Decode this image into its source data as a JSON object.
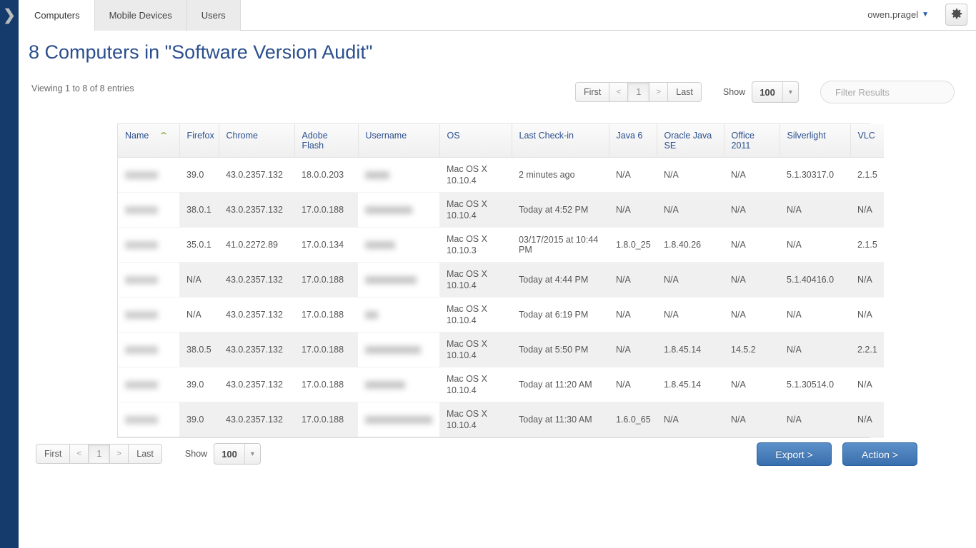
{
  "sidebar": {
    "toggle_icon": "chevron-right-icon"
  },
  "header": {
    "tabs": [
      {
        "label": "Computers",
        "active": true
      },
      {
        "label": "Mobile Devices",
        "active": false
      },
      {
        "label": "Users",
        "active": false
      }
    ],
    "username": "owen.pragel",
    "caret": "▼",
    "gear_icon": "gear-icon"
  },
  "page": {
    "title": "8 Computers in \"Software Version Audit\"",
    "viewing": "Viewing 1 to 8 of 8 entries"
  },
  "pagination": {
    "first": "First",
    "prev": "<",
    "current": "1",
    "next": ">",
    "last": "Last"
  },
  "show": {
    "label": "Show",
    "value": "100",
    "chevron": "chevron-down-icon",
    "options": [
      "100"
    ]
  },
  "filter": {
    "placeholder": "Filter Results",
    "value": ""
  },
  "buttons": {
    "export": "Export >",
    "action": "Action >"
  },
  "colors": {
    "sidebar": "#143b6b",
    "heading": "#2b4f8e",
    "header_link": "#2b4f8e",
    "sort_arrow": "#95b94a",
    "primary_button": "#3a6fae",
    "row_stripe": "#f0f0f0"
  },
  "table": {
    "sort_column": "Name",
    "sort_direction": "ascending",
    "columns": [
      "Name",
      "Firefox",
      "Chrome",
      "Adobe Flash",
      "Username",
      "OS",
      "Last Check-in",
      "Java 6",
      "Oracle Java SE",
      "Office 2011",
      "Silverlight",
      "VLC"
    ],
    "rows": [
      {
        "name": "",
        "name_redacted": true,
        "firefox": "39.0",
        "chrome": "43.0.2357.132",
        "flash": "18.0.0.203",
        "username": "",
        "username_redacted": true,
        "username_width": 34,
        "os": "Mac OS X 10.10.4",
        "checkin": "2 minutes ago",
        "java6": "N/A",
        "oraclejava": "N/A",
        "office": "N/A",
        "silverlight": "5.1.30317.0",
        "vlc": "2.1.5"
      },
      {
        "name": "",
        "name_redacted": true,
        "firefox": "38.0.1",
        "chrome": "43.0.2357.132",
        "flash": "17.0.0.188",
        "username": "",
        "username_redacted": true,
        "username_width": 66,
        "os": "Mac OS X 10.10.4",
        "checkin": "Today at 4:52 PM",
        "java6": "N/A",
        "oraclejava": "N/A",
        "office": "N/A",
        "silverlight": "N/A",
        "vlc": "N/A"
      },
      {
        "name": "",
        "name_redacted": true,
        "firefox": "35.0.1",
        "chrome": "41.0.2272.89",
        "flash": "17.0.0.134",
        "username": "",
        "username_redacted": true,
        "username_width": 42,
        "os": "Mac OS X 10.10.3",
        "checkin": "03/17/2015 at 10:44 PM",
        "java6": "1.8.0_25",
        "oraclejava": "1.8.40.26",
        "office": "N/A",
        "silverlight": "N/A",
        "vlc": "2.1.5"
      },
      {
        "name": "",
        "name_redacted": true,
        "firefox": "N/A",
        "chrome": "43.0.2357.132",
        "flash": "17.0.0.188",
        "username": "",
        "username_redacted": true,
        "username_width": 72,
        "os": "Mac OS X 10.10.4",
        "checkin": "Today at 4:44 PM",
        "java6": "N/A",
        "oraclejava": "N/A",
        "office": "N/A",
        "silverlight": "5.1.40416.0",
        "vlc": "N/A"
      },
      {
        "name": "",
        "name_redacted": true,
        "firefox": "N/A",
        "chrome": "43.0.2357.132",
        "flash": "17.0.0.188",
        "username": "",
        "username_redacted": true,
        "username_width": 18,
        "os": "Mac OS X 10.10.4",
        "checkin": "Today at 6:19 PM",
        "java6": "N/A",
        "oraclejava": "N/A",
        "office": "N/A",
        "silverlight": "N/A",
        "vlc": "N/A"
      },
      {
        "name": "",
        "name_redacted": true,
        "firefox": "38.0.5",
        "chrome": "43.0.2357.132",
        "flash": "17.0.0.188",
        "username": "",
        "username_redacted": true,
        "username_width": 78,
        "os": "Mac OS X 10.10.4",
        "checkin": "Today at 5:50 PM",
        "java6": "N/A",
        "oraclejava": "1.8.45.14",
        "office": "14.5.2",
        "silverlight": "N/A",
        "vlc": "2.2.1"
      },
      {
        "name": "",
        "name_redacted": true,
        "firefox": "39.0",
        "chrome": "43.0.2357.132",
        "flash": "17.0.0.188",
        "username": "",
        "username_redacted": true,
        "username_width": 56,
        "os": "Mac OS X 10.10.4",
        "checkin": "Today at 11:20 AM",
        "java6": "N/A",
        "oraclejava": "1.8.45.14",
        "office": "N/A",
        "silverlight": "5.1.30514.0",
        "vlc": "N/A"
      },
      {
        "name": "",
        "name_redacted": true,
        "firefox": "39.0",
        "chrome": "43.0.2357.132",
        "flash": "17.0.0.188",
        "username": "",
        "username_redacted": true,
        "username_width": 94,
        "os": "Mac OS X 10.10.4",
        "checkin": "Today at 11:30 AM",
        "java6": "1.6.0_65",
        "oraclejava": "N/A",
        "office": "N/A",
        "silverlight": "N/A",
        "vlc": "N/A"
      }
    ]
  }
}
